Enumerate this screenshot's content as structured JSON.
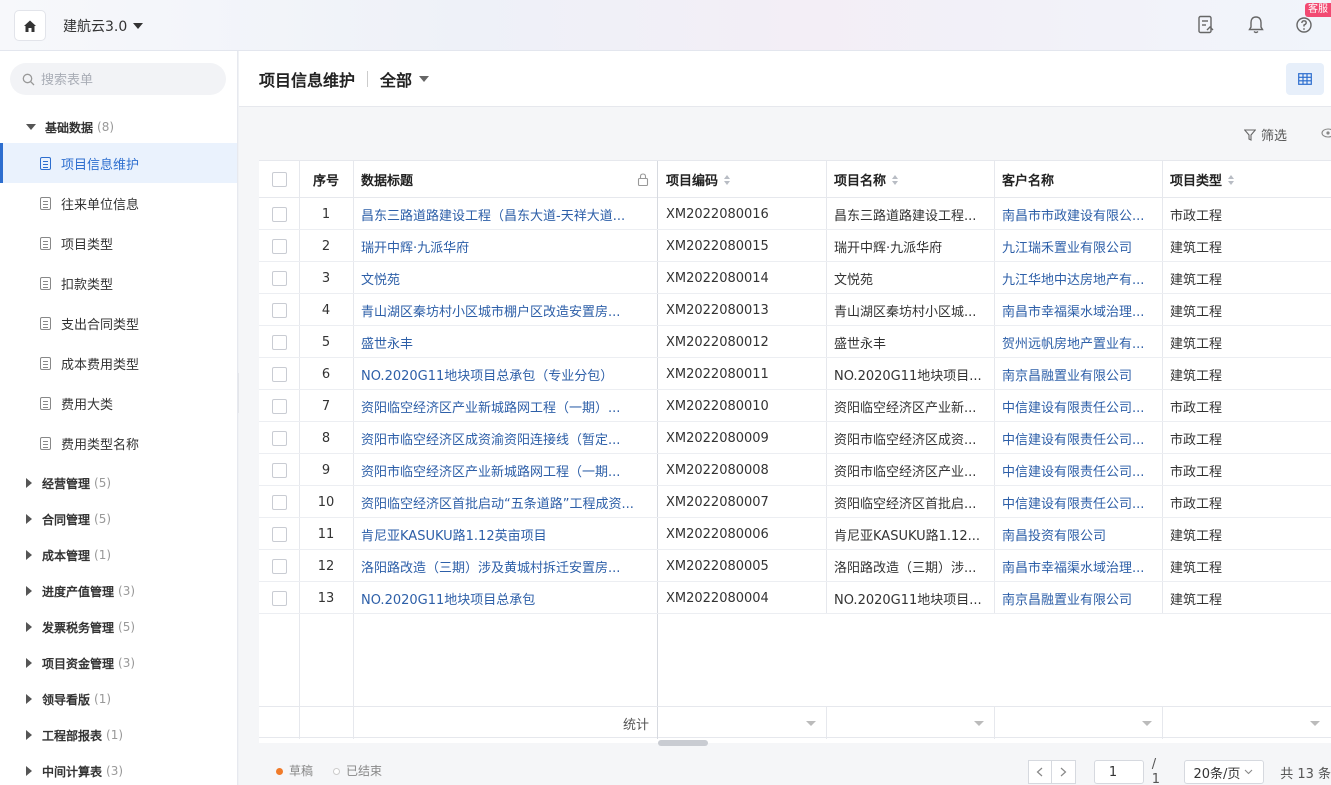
{
  "topbar": {
    "app_name": "建航云3.0",
    "badge": "客服"
  },
  "sidebar": {
    "search_placeholder": "搜索表单",
    "groups": [
      {
        "label": "基础数据",
        "count": "(8)"
      },
      {
        "label": "经营管理",
        "count": "(5)"
      },
      {
        "label": "合同管理",
        "count": "(5)"
      },
      {
        "label": "成本管理",
        "count": "(1)"
      },
      {
        "label": "进度产值管理",
        "count": "(3)"
      },
      {
        "label": "发票税务管理",
        "count": "(5)"
      },
      {
        "label": "项目资金管理",
        "count": "(3)"
      },
      {
        "label": "领导看版",
        "count": "(1)"
      },
      {
        "label": "工程部报表",
        "count": "(1)"
      },
      {
        "label": "中间计算表",
        "count": "(3)"
      }
    ],
    "items": [
      "项目信息维护",
      "往来单位信息",
      "项目类型",
      "扣款类型",
      "支出合同类型",
      "成本费用类型",
      "费用大类",
      "费用类型名称"
    ]
  },
  "header": {
    "title": "项目信息维护",
    "scope": "全部",
    "filter_label": "筛选"
  },
  "table": {
    "columns": [
      "序号",
      "数据标题",
      "项目编码",
      "项目名称",
      "客户名称",
      "项目类型"
    ],
    "rows": [
      [
        "1",
        "昌东三路道路建设工程（昌东大道-天祥大道...",
        "XM2022080016",
        "昌东三路道路建设工程...",
        "南昌市市政建设有限公...",
        "市政工程"
      ],
      [
        "2",
        "瑞开中辉·九派华府",
        "XM2022080015",
        "瑞开中辉·九派华府",
        "九江瑞禾置业有限公司",
        "建筑工程"
      ],
      [
        "3",
        "文悦苑",
        "XM2022080014",
        "文悦苑",
        "九江华地中达房地产有...",
        "建筑工程"
      ],
      [
        "4",
        "青山湖区秦坊村小区城市棚户区改造安置房...",
        "XM2022080013",
        "青山湖区秦坊村小区城...",
        "南昌市幸福渠水域治理...",
        "建筑工程"
      ],
      [
        "5",
        "盛世永丰",
        "XM2022080012",
        "盛世永丰",
        "贺州远帆房地产置业有...",
        "建筑工程"
      ],
      [
        "6",
        "NO.2020G11地块项目总承包（专业分包）",
        "XM2022080011",
        "NO.2020G11地块项目...",
        "南京昌融置业有限公司",
        "建筑工程"
      ],
      [
        "7",
        "资阳临空经济区产业新城路网工程（一期）...",
        "XM2022080010",
        "资阳临空经济区产业新...",
        "中信建设有限责任公司...",
        "市政工程"
      ],
      [
        "8",
        "资阳市临空经济区成资渝资阳连接线（暂定...",
        "XM2022080009",
        "资阳市临空经济区成资...",
        "中信建设有限责任公司...",
        "市政工程"
      ],
      [
        "9",
        "资阳市临空经济区产业新城路网工程（一期...",
        "XM2022080008",
        "资阳市临空经济区产业...",
        "中信建设有限责任公司...",
        "市政工程"
      ],
      [
        "10",
        "资阳临空经济区首批启动“五条道路”工程成资...",
        "XM2022080007",
        "资阳临空经济区首批启...",
        "中信建设有限责任公司...",
        "市政工程"
      ],
      [
        "11",
        "肯尼亚KASUKU路1.12英亩项目",
        "XM2022080006",
        "肯尼亚KASUKU路1.12...",
        "南昌投资有限公司",
        "建筑工程"
      ],
      [
        "12",
        "洛阳路改造（三期）涉及黄城村拆迁安置房...",
        "XM2022080005",
        "洛阳路改造（三期）涉...",
        "南昌市幸福渠水域治理...",
        "建筑工程"
      ],
      [
        "13",
        "NO.2020G11地块项目总承包",
        "XM2022080004",
        "NO.2020G11地块项目...",
        "南京昌融置业有限公司",
        "建筑工程"
      ]
    ],
    "footer_label": "统计"
  },
  "status_legend": [
    {
      "label": "草稿",
      "color": "#f07b2a"
    },
    {
      "label": "已结束",
      "color": "#ffffff"
    }
  ],
  "pagination": {
    "current": "1",
    "total_pages": "/ 1",
    "page_size": "20条/页",
    "total": "共 13 条"
  },
  "colors": {
    "accent": "#2d6ecf",
    "link": "#2d5fa8",
    "badge": "#f24a72"
  }
}
